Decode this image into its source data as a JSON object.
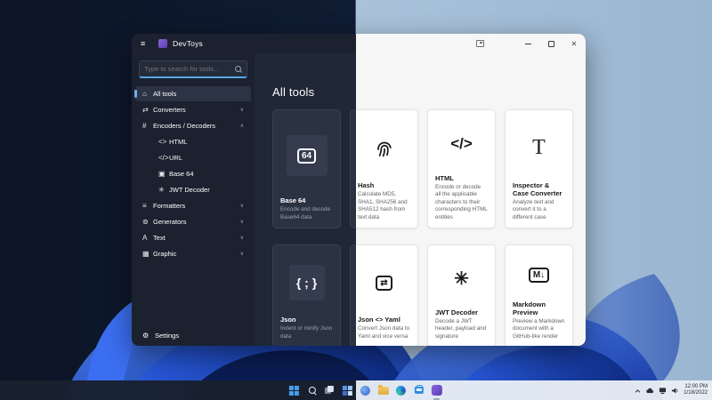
{
  "window": {
    "title": "DevToys",
    "titlebar": {
      "minimize_glyph": "",
      "maximize_glyph": "",
      "close_glyph": "✕"
    }
  },
  "sidebar": {
    "search_placeholder": "Type to search for tools...",
    "items": [
      {
        "label": "All tools",
        "icon": "⌂",
        "chevron": ""
      },
      {
        "label": "Converters",
        "icon": "⇄",
        "chevron": "∨"
      },
      {
        "label": "Encoders / Decoders",
        "icon": "#",
        "chevron": "∧"
      },
      {
        "label": "HTML",
        "icon": "<>",
        "chevron": ""
      },
      {
        "label": "URL",
        "icon": "</>",
        "chevron": ""
      },
      {
        "label": "Base 64",
        "icon": "▣",
        "chevron": ""
      },
      {
        "label": "JWT Decoder",
        "icon": "✳",
        "chevron": ""
      },
      {
        "label": "Formatters",
        "icon": "≡",
        "chevron": "∨"
      },
      {
        "label": "Generators",
        "icon": "⊚",
        "chevron": "∨"
      },
      {
        "label": "Text",
        "icon": "A",
        "chevron": "∨"
      },
      {
        "label": "Graphic",
        "icon": "▦",
        "chevron": "∨"
      }
    ],
    "settings": {
      "label": "Settings",
      "icon": "⚙"
    }
  },
  "main": {
    "title": "All tools",
    "cards": [
      {
        "title": "Base 64",
        "glyph": "64",
        "desc": "Encode and decode Base64 data"
      },
      {
        "title": "Hash",
        "glyph": "",
        "desc": "Calculate MD5, SHA1, SHA256 and SHA512 hash from text data"
      },
      {
        "title": "HTML",
        "glyph": "</>",
        "desc": "Encode or decode all the applicable characters to their corresponding HTML entities"
      },
      {
        "title": "Inspector & Case Converter",
        "glyph": "T",
        "desc": "Analyze text and convert it to a different case"
      },
      {
        "title": "Json",
        "glyph": "{ ; }",
        "desc": "Indent or minify Json data"
      },
      {
        "title": "Json <> Yaml",
        "glyph": "⇄",
        "desc": "Convert Json data to Yaml and vice versa"
      },
      {
        "title": "JWT Decoder",
        "glyph": "✳",
        "desc": "Decode a JWT header, payload and signature"
      },
      {
        "title": "Markdown Preview",
        "glyph": "M↓",
        "desc": "Preview a Markdown document with a GitHub-like render"
      }
    ]
  },
  "taskbar": {
    "clock": {
      "time": "12:00 PM",
      "date": "1/18/2022"
    }
  },
  "colors": {
    "accent": "#59a7e8",
    "devtoys_purple": "#7a5bd0",
    "selection": "#6db1f0"
  }
}
